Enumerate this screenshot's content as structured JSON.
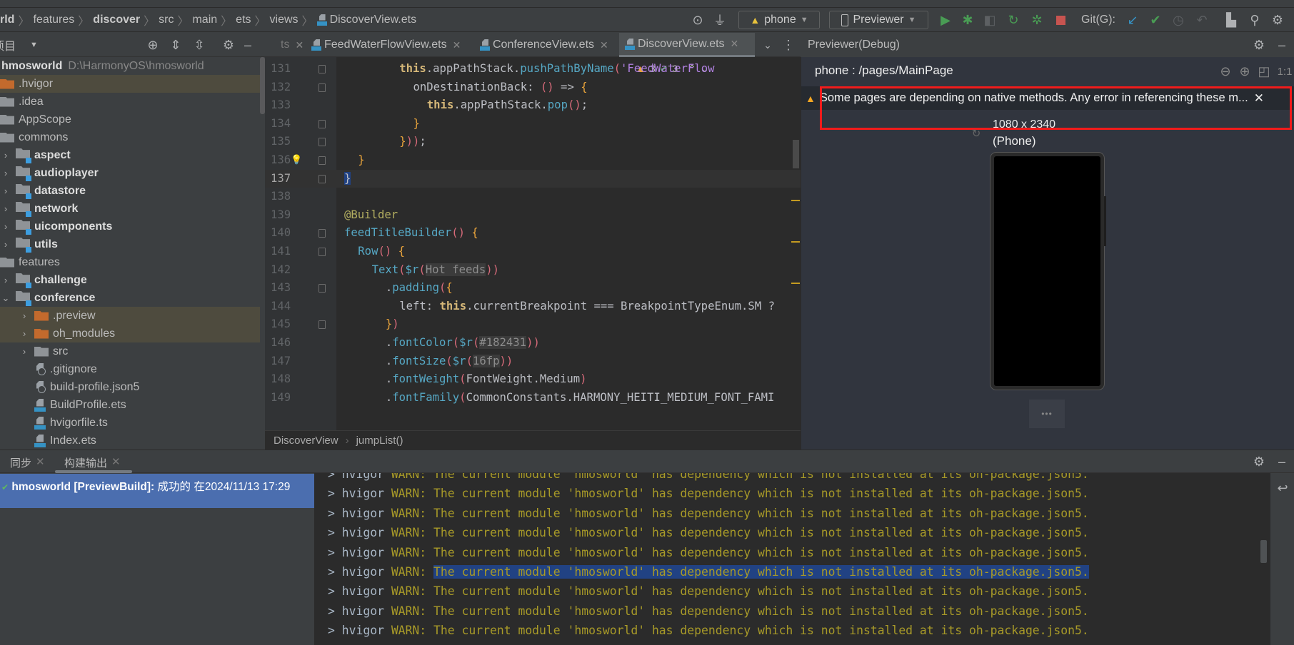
{
  "breadcrumb": {
    "items": [
      "rld",
      "features",
      "discover",
      "src",
      "main",
      "ets",
      "views"
    ],
    "file": "DiscoverView.ets"
  },
  "toolbar": {
    "device": "phone",
    "run_target": "Previewer",
    "git_label": "Git(G):",
    "icons": [
      "target-icon",
      "plug-icon",
      "run-icon",
      "debug-icon",
      "attach-icon",
      "reload-icon",
      "profile-icon",
      "stop-icon",
      "git-update-icon",
      "git-commit-icon",
      "git-history-icon",
      "git-rollback-icon",
      "project-structure-icon",
      "search-icon",
      "settings-icon"
    ],
    "colors": {
      "run": "#499c54",
      "stop": "#c75450",
      "git_update": "#3592c4",
      "git_commit": "#499c54"
    }
  },
  "project_panel": {
    "title": "项目",
    "root": {
      "name": "hmosworld",
      "path": "D:\\HarmonyOS\\hmosworld"
    },
    "items": [
      {
        "name": ".hvigor",
        "kind": "folder-orange",
        "depth": 0,
        "hl": true
      },
      {
        "name": ".idea",
        "kind": "folder",
        "depth": 0
      },
      {
        "name": "AppScope",
        "kind": "folder",
        "depth": 0
      },
      {
        "name": "commons",
        "kind": "folder",
        "depth": 0
      },
      {
        "name": "aspect",
        "kind": "module",
        "depth": 1,
        "chev": ">"
      },
      {
        "name": "audioplayer",
        "kind": "module",
        "depth": 1,
        "chev": ">"
      },
      {
        "name": "datastore",
        "kind": "module",
        "depth": 1,
        "chev": ">"
      },
      {
        "name": "network",
        "kind": "module",
        "depth": 1,
        "chev": ">"
      },
      {
        "name": "uicomponents",
        "kind": "module",
        "depth": 1,
        "chev": ">"
      },
      {
        "name": "utils",
        "kind": "module",
        "depth": 1,
        "chev": ">"
      },
      {
        "name": "features",
        "kind": "folder",
        "depth": 0
      },
      {
        "name": "challenge",
        "kind": "module",
        "depth": 1,
        "chev": ">"
      },
      {
        "name": "conference",
        "kind": "module",
        "depth": 1,
        "chev": "v"
      },
      {
        "name": ".preview",
        "kind": "folder-orange",
        "depth": 2,
        "chev": ">",
        "hl": true
      },
      {
        "name": "oh_modules",
        "kind": "folder-orange",
        "depth": 2,
        "chev": ">",
        "hl": true
      },
      {
        "name": "src",
        "kind": "folder",
        "depth": 2,
        "chev": ">"
      },
      {
        "name": ".gitignore",
        "kind": "file-cfg",
        "depth": 3
      },
      {
        "name": "build-profile.json5",
        "kind": "file-cfg",
        "depth": 3
      },
      {
        "name": "BuildProfile.ets",
        "kind": "file-ets",
        "depth": 3
      },
      {
        "name": "hvigorfile.ts",
        "kind": "file-ts",
        "depth": 3
      },
      {
        "name": "Index.ets",
        "kind": "file-ets",
        "depth": 3
      }
    ]
  },
  "editor": {
    "tabs": [
      {
        "label": "ts",
        "partial": true
      },
      {
        "label": "FeedWaterFlowView.ets"
      },
      {
        "label": "ConferenceView.ets"
      },
      {
        "label": "DiscoverView.ets",
        "active": true
      }
    ],
    "inspections": {
      "warnings": "3",
      "weak_warnings": "3"
    },
    "current_line": 137,
    "lines": [
      {
        "n": 131,
        "fold": true,
        "indent": 4,
        "tokens": [
          [
            "this",
            "this"
          ],
          [
            ".",
            "plain"
          ],
          [
            "appPathStack",
            "plain"
          ],
          [
            ".",
            "plain"
          ],
          [
            "pushPathByName",
            "fn"
          ],
          [
            "(",
            "paren"
          ],
          [
            "'FeedWaterFlow",
            "str"
          ]
        ]
      },
      {
        "n": 132,
        "fold": true,
        "indent": 5,
        "tokens": [
          [
            "onDestinationBack: ",
            "plain"
          ],
          [
            "()",
            "paren"
          ],
          [
            " => ",
            "plain"
          ],
          [
            "{",
            "brace"
          ]
        ]
      },
      {
        "n": 133,
        "indent": 6,
        "tokens": [
          [
            "this",
            "this"
          ],
          [
            ".appPathStack.",
            "plain"
          ],
          [
            "pop",
            "fn"
          ],
          [
            "()",
            "paren"
          ],
          [
            ";",
            "plain"
          ]
        ]
      },
      {
        "n": 134,
        "fold": true,
        "indent": 5,
        "tokens": [
          [
            "}",
            "brace"
          ]
        ]
      },
      {
        "n": 135,
        "fold": true,
        "indent": 4,
        "tokens": [
          [
            "}",
            "brace"
          ],
          [
            "))",
            "paren"
          ],
          [
            ";",
            "plain"
          ]
        ]
      },
      {
        "n": 136,
        "fold": true,
        "bulb": true,
        "indent": 1,
        "tokens": [
          [
            "}",
            "brace"
          ]
        ]
      },
      {
        "n": 137,
        "fold": true,
        "indent": 0,
        "tokens": [
          [
            "}",
            "sel"
          ]
        ]
      },
      {
        "n": 138,
        "indent": 0,
        "tokens": []
      },
      {
        "n": 139,
        "indent": 0,
        "tokens": [
          [
            "@Builder",
            "ann"
          ]
        ]
      },
      {
        "n": 140,
        "fold": true,
        "indent": 0,
        "tokens": [
          [
            "feedTitleBuilder",
            "fn"
          ],
          [
            "()",
            "paren"
          ],
          [
            " ",
            "plain"
          ],
          [
            "{",
            "brace"
          ]
        ]
      },
      {
        "n": 141,
        "fold": true,
        "indent": 1,
        "tokens": [
          [
            "Row",
            "fn"
          ],
          [
            "()",
            "paren"
          ],
          [
            " ",
            "plain"
          ],
          [
            "{",
            "brace"
          ]
        ]
      },
      {
        "n": 142,
        "indent": 2,
        "tokens": [
          [
            "Text",
            "fn"
          ],
          [
            "(",
            "paren"
          ],
          [
            "$r",
            "fn"
          ],
          [
            "(",
            "paren"
          ],
          [
            "Hot feeds",
            "res"
          ],
          [
            "))",
            "paren"
          ]
        ]
      },
      {
        "n": 143,
        "fold": true,
        "indent": 3,
        "tokens": [
          [
            ".",
            "plain"
          ],
          [
            "padding",
            "fn"
          ],
          [
            "(",
            "paren"
          ],
          [
            "{",
            "brace"
          ]
        ]
      },
      {
        "n": 144,
        "indent": 4,
        "tokens": [
          [
            "left: ",
            "plain"
          ],
          [
            "this",
            "this"
          ],
          [
            ".currentBreakpoint === BreakpointTypeEnum.SM ?",
            "plain"
          ]
        ]
      },
      {
        "n": 145,
        "fold": true,
        "indent": 3,
        "tokens": [
          [
            "}",
            "brace"
          ],
          [
            ")",
            "paren"
          ]
        ]
      },
      {
        "n": 146,
        "indent": 3,
        "tokens": [
          [
            ".",
            "plain"
          ],
          [
            "fontColor",
            "fn"
          ],
          [
            "(",
            "paren"
          ],
          [
            "$r",
            "fn"
          ],
          [
            "(",
            "paren"
          ],
          [
            "#182431",
            "res"
          ],
          [
            "))",
            "paren"
          ]
        ]
      },
      {
        "n": 147,
        "indent": 3,
        "tokens": [
          [
            ".",
            "plain"
          ],
          [
            "fontSize",
            "fn"
          ],
          [
            "(",
            "paren"
          ],
          [
            "$r",
            "fn"
          ],
          [
            "(",
            "paren"
          ],
          [
            "16fp",
            "res"
          ],
          [
            "))",
            "paren"
          ]
        ]
      },
      {
        "n": 148,
        "indent": 3,
        "tokens": [
          [
            ".",
            "plain"
          ],
          [
            "fontWeight",
            "fn"
          ],
          [
            "(",
            "paren"
          ],
          [
            "FontWeight.Medium",
            "plain"
          ],
          [
            ")",
            "paren"
          ]
        ]
      },
      {
        "n": 149,
        "indent": 3,
        "tokens": [
          [
            ".",
            "plain"
          ],
          [
            "fontFamily",
            "fn"
          ],
          [
            "(",
            "paren"
          ],
          [
            "CommonConstants.HARMONY_HEITI_MEDIUM_FONT_FAMI",
            "plain"
          ]
        ]
      }
    ],
    "breadcrumb": [
      "DiscoverView",
      "jumpList()"
    ]
  },
  "previewer": {
    "title": "Previewer(Debug)",
    "page": "phone : /pages/MainPage",
    "zoom_controls": [
      "zoom-out-icon",
      "zoom-in-icon",
      "fit-icon",
      "1:1"
    ],
    "warning": "Some pages are depending on native methods. Any error in referencing these m...",
    "resolution": "1080 x 2340",
    "device_type": "(Phone)",
    "more_label": "•••"
  },
  "bottom": {
    "tabs": [
      {
        "label": "同步"
      },
      {
        "label": "构建输出",
        "active": true
      }
    ],
    "build": {
      "project": "hmosworld [PreviewBuild]:",
      "status": "成功的",
      "time": "在2024/11/13 17:29"
    },
    "console": {
      "prefix": "> hvigor ",
      "level": "WARN:",
      "message": "The current module 'hmosworld' has dependency which is not installed at its oh-package.json5.",
      "count": 10,
      "selected_index": 5
    }
  }
}
